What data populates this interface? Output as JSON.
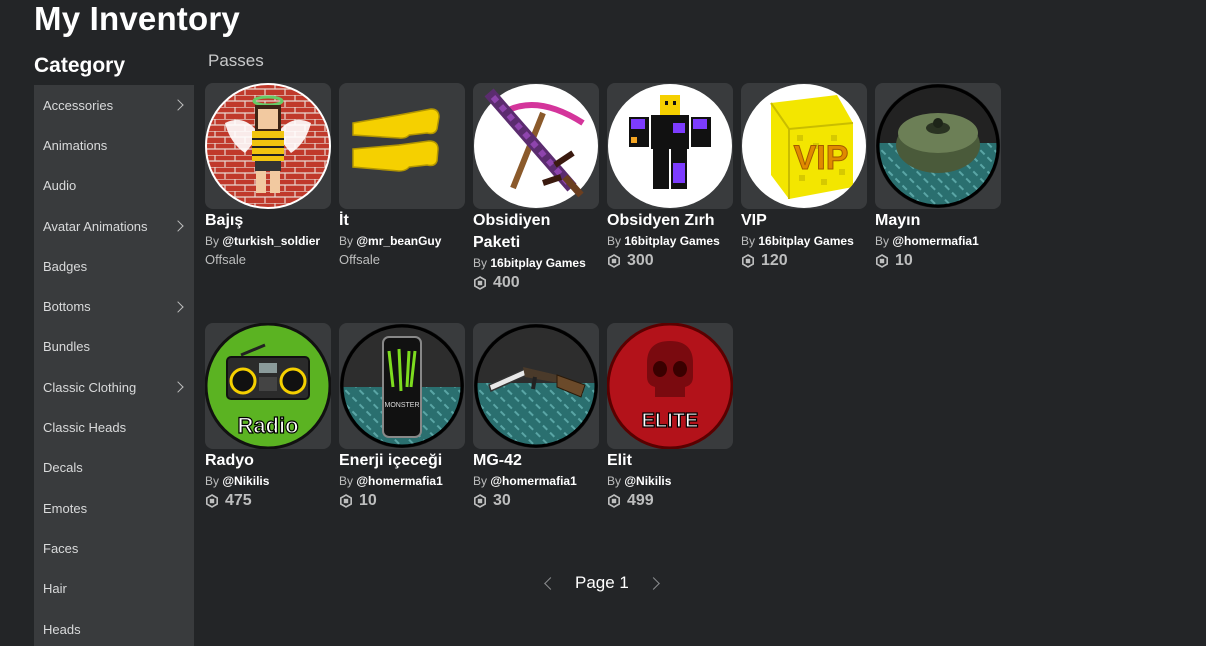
{
  "header": {
    "title": "My Inventory"
  },
  "sidebar": {
    "title": "Category",
    "items": [
      {
        "label": "Accessories",
        "chevron": true
      },
      {
        "label": "Animations",
        "chevron": false
      },
      {
        "label": "Audio",
        "chevron": false
      },
      {
        "label": "Avatar Animations",
        "chevron": true
      },
      {
        "label": "Badges",
        "chevron": false
      },
      {
        "label": "Bottoms",
        "chevron": true
      },
      {
        "label": "Bundles",
        "chevron": false
      },
      {
        "label": "Classic Clothing",
        "chevron": true
      },
      {
        "label": "Classic Heads",
        "chevron": false
      },
      {
        "label": "Decals",
        "chevron": false
      },
      {
        "label": "Emotes",
        "chevron": false
      },
      {
        "label": "Faces",
        "chevron": false
      },
      {
        "label": "Hair",
        "chevron": false
      },
      {
        "label": "Heads",
        "chevron": false
      }
    ]
  },
  "main": {
    "section_title": "Passes",
    "by_prefix": "By",
    "items": [
      {
        "name": "Bajış",
        "creator": "@turkish_soldier",
        "status": "Offsale",
        "price": null,
        "icon": "girl-avatar-icon"
      },
      {
        "name": "İt",
        "creator": "@mr_beanGuy",
        "status": "Offsale",
        "price": null,
        "icon": "yellow-arms-icon"
      },
      {
        "name": "Obsidiyen Paketi",
        "creator": "16bitplay Games",
        "status": null,
        "price": "400",
        "icon": "pixel-sword-pickaxe-icon"
      },
      {
        "name": "Obsidyen Zırh",
        "creator": "16bitplay Games",
        "status": null,
        "price": "300",
        "icon": "armor-avatar-icon"
      },
      {
        "name": "VIP",
        "creator": "16bitplay Games",
        "status": null,
        "price": "120",
        "icon": "vip-block-icon"
      },
      {
        "name": "Mayın",
        "creator": "@homermafia1",
        "status": null,
        "price": "10",
        "icon": "landmine-icon"
      },
      {
        "name": "Radyo",
        "creator": "@Nikilis",
        "status": null,
        "price": "475",
        "icon": "radio-icon"
      },
      {
        "name": "Enerji içeceği",
        "creator": "@homermafia1",
        "status": null,
        "price": "10",
        "icon": "energy-drink-icon"
      },
      {
        "name": "MG-42",
        "creator": "@homermafia1",
        "status": null,
        "price": "30",
        "icon": "gun-icon"
      },
      {
        "name": "Elit",
        "creator": "@Nikilis",
        "status": null,
        "price": "499",
        "icon": "skull-elite-icon"
      }
    ]
  },
  "pager": {
    "label": "Page 1"
  },
  "thumb_text": {
    "vip": "VIP",
    "radio": "Radio",
    "elite": "ELITE",
    "monster": "MONSTER"
  },
  "colors": {
    "background": "#232527",
    "panel": "#393b3d",
    "text": "#ffffff",
    "muted": "#bdbebe"
  }
}
